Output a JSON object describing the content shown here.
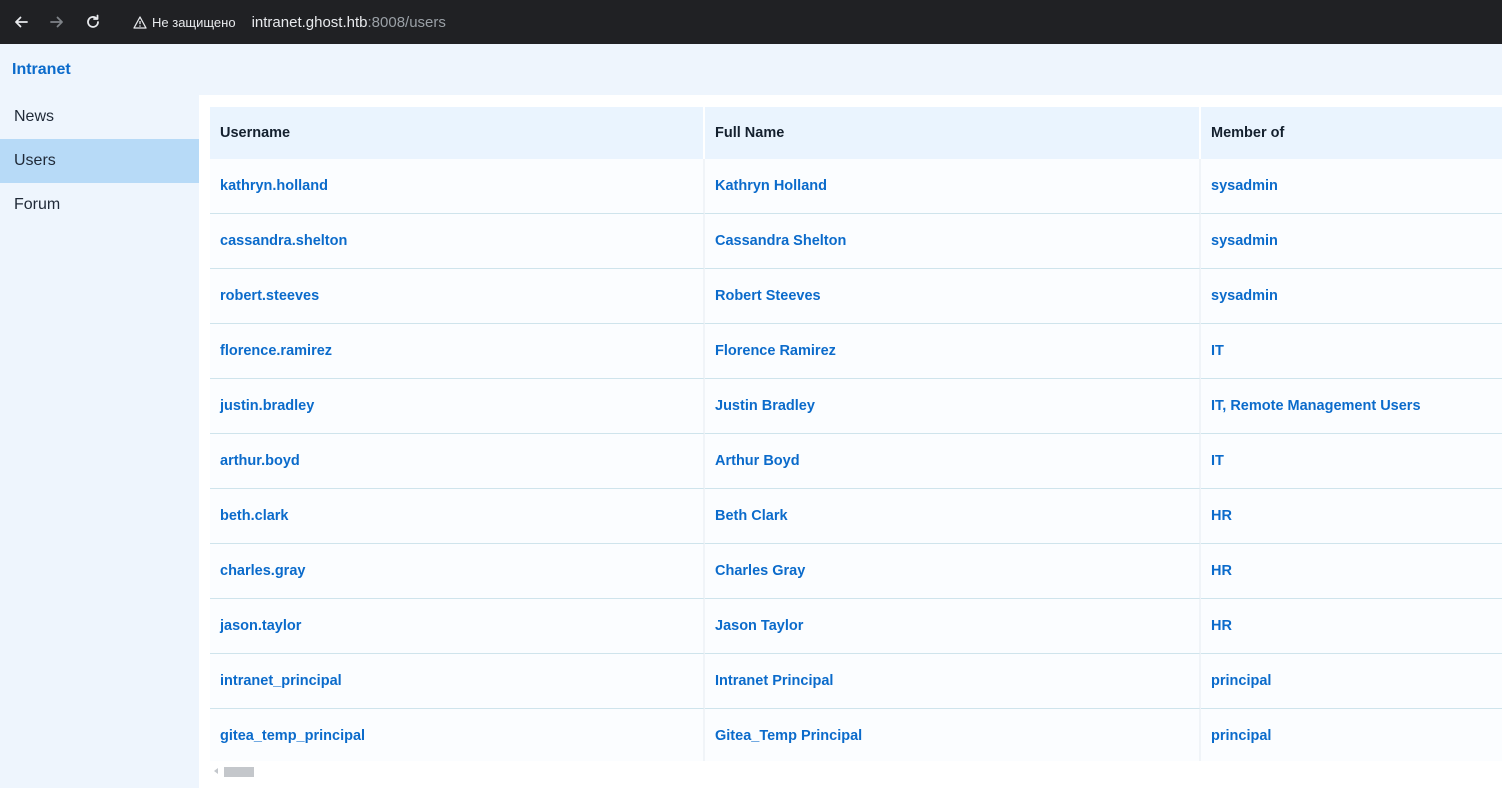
{
  "browser": {
    "back_icon": "arrow-left-icon",
    "forward_icon": "arrow-right-icon",
    "reload_icon": "reload-icon",
    "security_icon": "warning-triangle-icon",
    "security_label": "Не защищено",
    "url_host": "intranet.ghost.htb",
    "url_rest": ":8008/users"
  },
  "app": {
    "brand": "Intranet",
    "sidebar": {
      "items": [
        {
          "label": "News"
        },
        {
          "label": "Users",
          "active": true
        },
        {
          "label": "Forum"
        }
      ]
    }
  },
  "table": {
    "headers": [
      "Username",
      "Full Name",
      "Member of"
    ],
    "rows": [
      [
        "kathryn.holland",
        "Kathryn Holland",
        "sysadmin"
      ],
      [
        "cassandra.shelton",
        "Cassandra Shelton",
        "sysadmin"
      ],
      [
        "robert.steeves",
        "Robert Steeves",
        "sysadmin"
      ],
      [
        "florence.ramirez",
        "Florence Ramirez",
        "IT"
      ],
      [
        "justin.bradley",
        "Justin Bradley",
        "IT, Remote Management Users"
      ],
      [
        "arthur.boyd",
        "Arthur Boyd",
        "IT"
      ],
      [
        "beth.clark",
        "Beth Clark",
        "HR"
      ],
      [
        "charles.gray",
        "Charles Gray",
        "HR"
      ],
      [
        "jason.taylor",
        "Jason Taylor",
        "HR"
      ],
      [
        "intranet_principal",
        "Intranet Principal",
        "principal"
      ],
      [
        "gitea_temp_principal",
        "Gitea_Temp Principal",
        "principal"
      ]
    ]
  },
  "colors": {
    "chrome_bg": "#202124",
    "accent": "#0b6bcb",
    "sidebar_active": "#b7daf7",
    "page_bg": "#eef5fd"
  }
}
